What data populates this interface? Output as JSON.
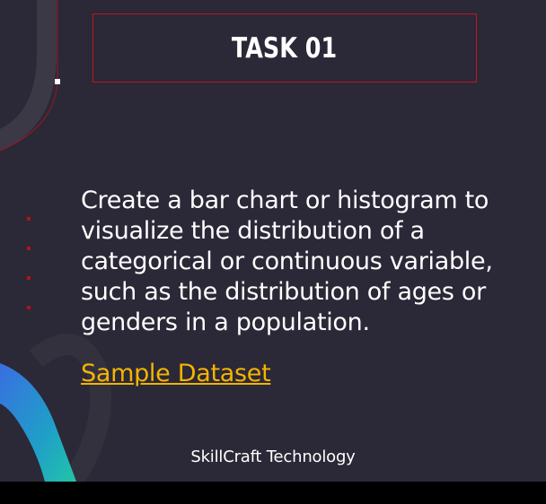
{
  "slide": {
    "title": "TASK 01",
    "description": "Create a bar chart or histogram to visualize the distribution of a categorical or continuous variable, such as the distribution of ages or genders in a population.",
    "link_label": "Sample Dataset",
    "footer": "SkillCraft Technology"
  },
  "colors": {
    "background": "#2b2837",
    "title_border": "#c0161c",
    "link": "#f4b400",
    "bullet": "#b01418"
  },
  "icons": [
    "decorative-arc-icon",
    "decorative-wave-icon",
    "bullet-dot-icon"
  ]
}
